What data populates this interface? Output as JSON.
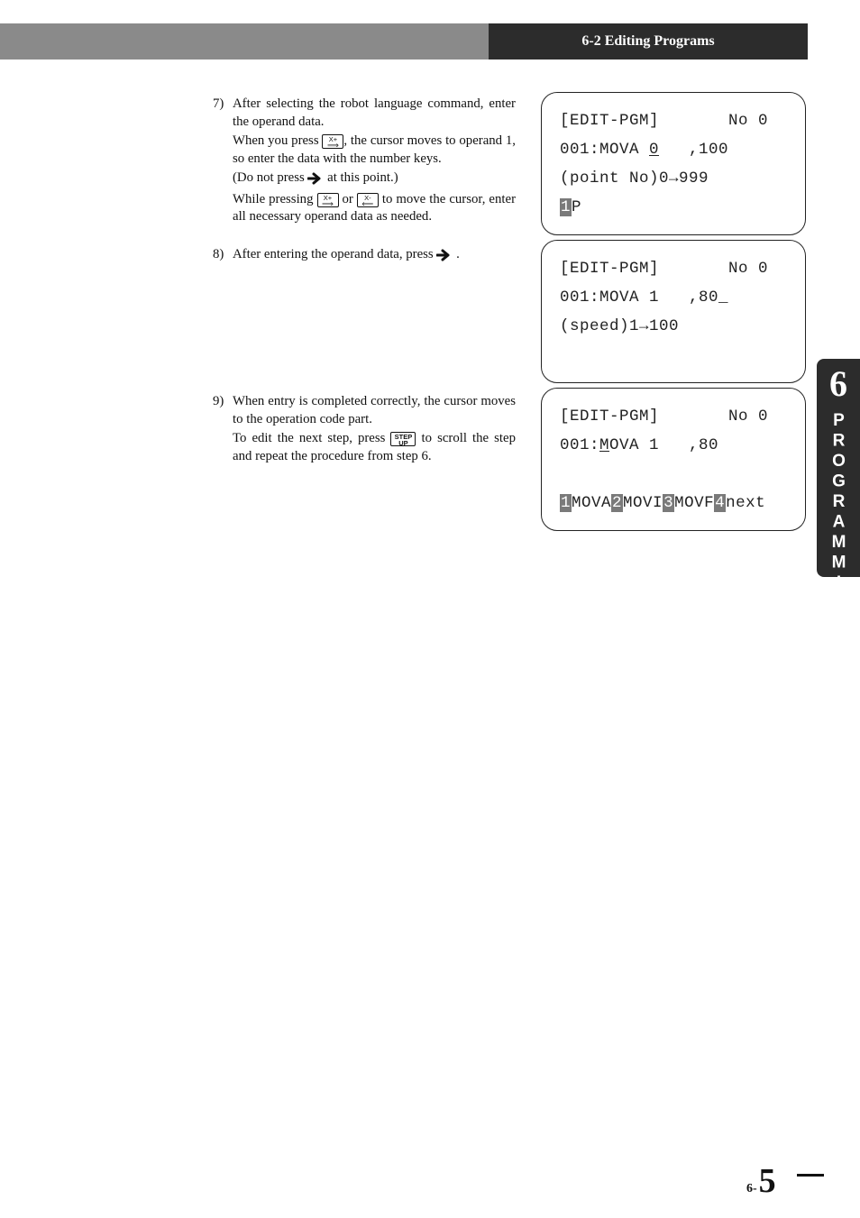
{
  "header": {
    "section_title": "6-2 Editing Programs"
  },
  "side_tab": {
    "chapter_number": "6",
    "chapter_title": "PROGRAMMING"
  },
  "steps": {
    "s7": {
      "num": "7)",
      "p1": "After selecting the robot language command, enter the operand data.",
      "p2a": "When you press ",
      "p2b": ", the cursor moves to operand 1, so enter the data with the number keys.",
      "p3a": "(Do not press ",
      "p3b": " at this point.)",
      "p4a": "While pressing ",
      "p4b": " or ",
      "p4c": " to move the cursor, enter all necessary operand data as needed."
    },
    "s8": {
      "num": "8)",
      "p1a": "After entering the operand data, press ",
      "p1b": " ."
    },
    "s9": {
      "num": "9)",
      "p1": "When entry is completed correctly, the cursor moves to the operation code part.",
      "p2a": "To edit the next step, press ",
      "p2b": " to scroll the step and repeat the procedure from step 6."
    }
  },
  "key_labels": {
    "x_plus_top": "X+",
    "x_plus_arrow": "⟹",
    "x_minus_top": "X-",
    "x_minus_arrow": "⟸",
    "step_top": "STEP",
    "step_bottom": "UP"
  },
  "lcd1": {
    "r1": "[EDIT-PGM]       No 0",
    "r2a": "001:MOVA ",
    "r2b": "0",
    "r2c": "   ,100",
    "r3": "(point No)0→999",
    "r4hl": "1",
    "r4rest": "P"
  },
  "lcd2": {
    "r1": "[EDIT-PGM]       No 0",
    "r2": "001:MOVA 1   ,80_",
    "r3": "(speed)1→100",
    "r4": " "
  },
  "lcd3": {
    "r1": "[EDIT-PGM]       No 0",
    "r2a": "001:",
    "r2b": "M",
    "r2c": "OVA 1   ,80",
    "r3": " ",
    "r4_1": "1",
    "r4_1t": "MOVA",
    "r4_2": "2",
    "r4_2t": "MOVI",
    "r4_3": "3",
    "r4_3t": "MOVF",
    "r4_4": "4",
    "r4_4t": "next"
  },
  "pagenum": {
    "prefix": "6-",
    "big": "5"
  }
}
